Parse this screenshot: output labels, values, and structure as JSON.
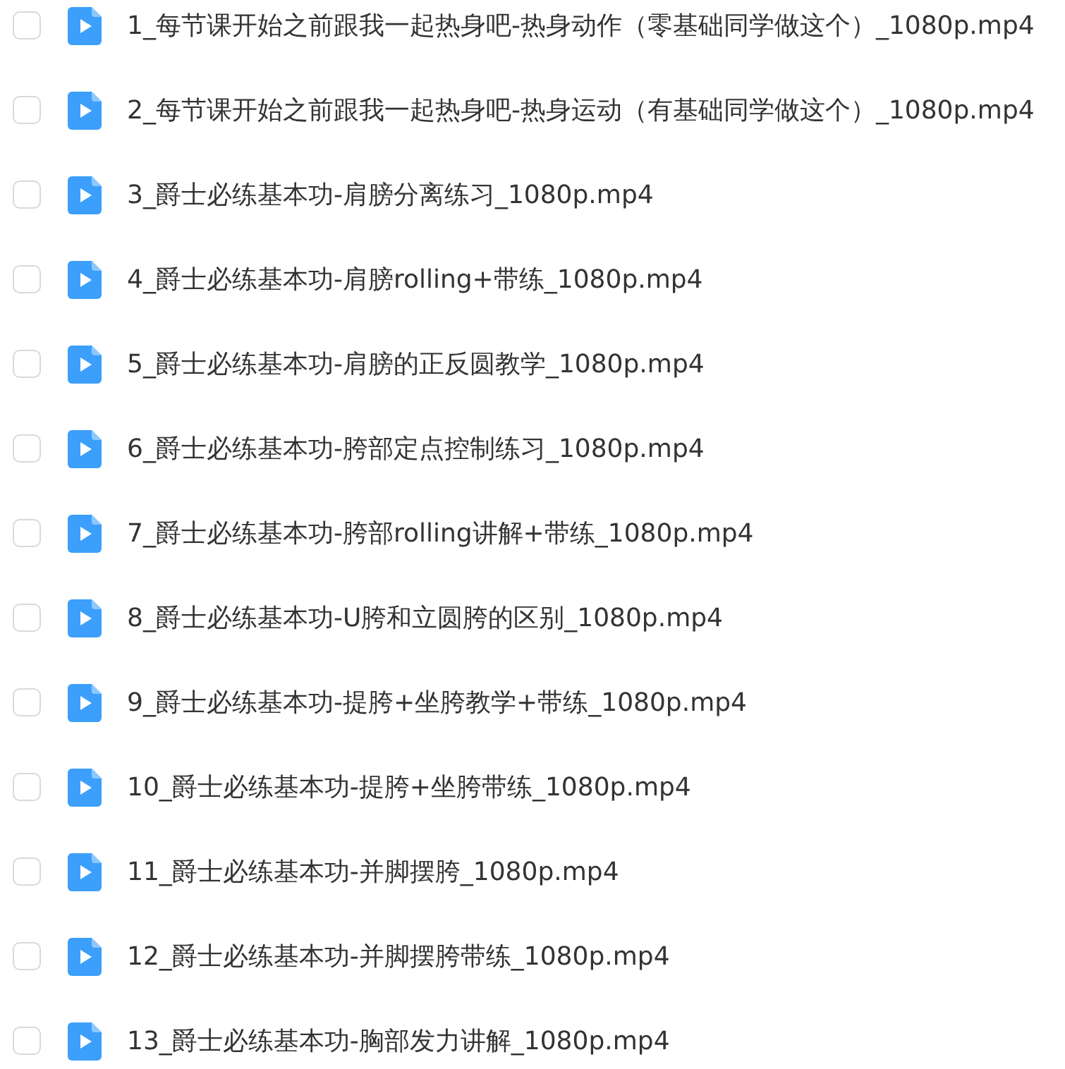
{
  "files": [
    {
      "name": "1_每节课开始之前跟我一起热身吧-热身动作（零基础同学做这个）_1080p.mp4",
      "checked": false
    },
    {
      "name": "2_每节课开始之前跟我一起热身吧-热身运动（有基础同学做这个）_1080p.mp4",
      "checked": false
    },
    {
      "name": "3_爵士必练基本功-肩膀分离练习_1080p.mp4",
      "checked": false
    },
    {
      "name": "4_爵士必练基本功-肩膀rolling+带练_1080p.mp4",
      "checked": false
    },
    {
      "name": "5_爵士必练基本功-肩膀的正反圆教学_1080p.mp4",
      "checked": false
    },
    {
      "name": "6_爵士必练基本功-胯部定点控制练习_1080p.mp4",
      "checked": false
    },
    {
      "name": "7_爵士必练基本功-胯部rolling讲解+带练_1080p.mp4",
      "checked": false
    },
    {
      "name": "8_爵士必练基本功-U胯和立圆胯的区别_1080p.mp4",
      "checked": false
    },
    {
      "name": "9_爵士必练基本功-提胯+坐胯教学+带练_1080p.mp4",
      "checked": false
    },
    {
      "name": "10_爵士必练基本功-提胯+坐胯带练_1080p.mp4",
      "checked": false
    },
    {
      "name": "11_爵士必练基本功-并脚摆胯_1080p.mp4",
      "checked": false
    },
    {
      "name": "12_爵士必练基本功-并脚摆胯带练_1080p.mp4",
      "checked": false
    },
    {
      "name": "13_爵士必练基本功-胸部发力讲解_1080p.mp4",
      "checked": false
    }
  ]
}
